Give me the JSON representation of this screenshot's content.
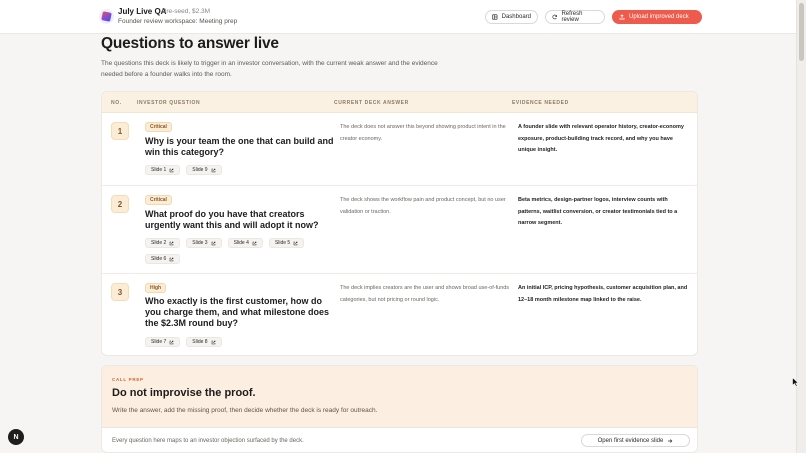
{
  "header": {
    "title": "July Live QA",
    "stage": "Pre-seed, $2.3M",
    "subtitle": "Founder review workspace: Meeting prep",
    "dashboard_label": "Dashboard",
    "refresh_label": "Refresh review",
    "upload_label": "Upload improved deck"
  },
  "section": {
    "title": "Questions to answer live",
    "description": "The questions this deck is likely to trigger in an investor conversation, with the current weak answer and the evidence needed before a founder walks into the room."
  },
  "table": {
    "columns": [
      "NO.",
      "INVESTOR QUESTION",
      "CURRENT DECK ANSWER",
      "EVIDENCE NEEDED"
    ],
    "rows": [
      {
        "number": "1",
        "severity": "Critical",
        "question": "Why is your team the one that can build and win this category?",
        "slides": [
          "Slide 1",
          "Slide 9"
        ],
        "answer": "The deck does not answer this beyond showing product intent in the creator economy.",
        "evidence": "A founder slide with relevant operator history, creator-economy exposure, product-building track record, and why you have unique insight."
      },
      {
        "number": "2",
        "severity": "Critical",
        "question": "What proof do you have that creators urgently want this and will adopt it now?",
        "slides": [
          "Slide 2",
          "Slide 3",
          "Slide 4",
          "Slide 5",
          "Slide 6"
        ],
        "answer": "The deck shows the workflow pain and product concept, but no user validation or traction.",
        "evidence": "Beta metrics, design-partner logos, interview counts with patterns, waitlist conversion, or creator testimonials tied to a narrow segment."
      },
      {
        "number": "3",
        "severity": "High",
        "question": "Who exactly is the first customer, how do you charge them, and what milestone does the $2.3M round buy?",
        "slides": [
          "Slide 7",
          "Slide 8"
        ],
        "answer": "The deck implies creators are the user and shows broad use-of-funds categories, but not pricing or round logic.",
        "evidence": "An initial ICP, pricing hypothesis, customer acquisition plan, and 12–18 month milestone map linked to the raise."
      }
    ]
  },
  "prep": {
    "tag": "CALL PREP",
    "title": "Do not improvise the proof.",
    "description": "Write the answer, add the missing proof, then decide whether the deck is ready for outreach.",
    "note": "Every question here maps to an investor objection surfaced by the deck.",
    "button_label": "Open first evidence slide"
  },
  "fab": {
    "label": "N"
  },
  "colors": {
    "accent": "#ee5a4c",
    "badge_bg": "#fbecd6",
    "header_row_bg": "#fbf1e3"
  }
}
